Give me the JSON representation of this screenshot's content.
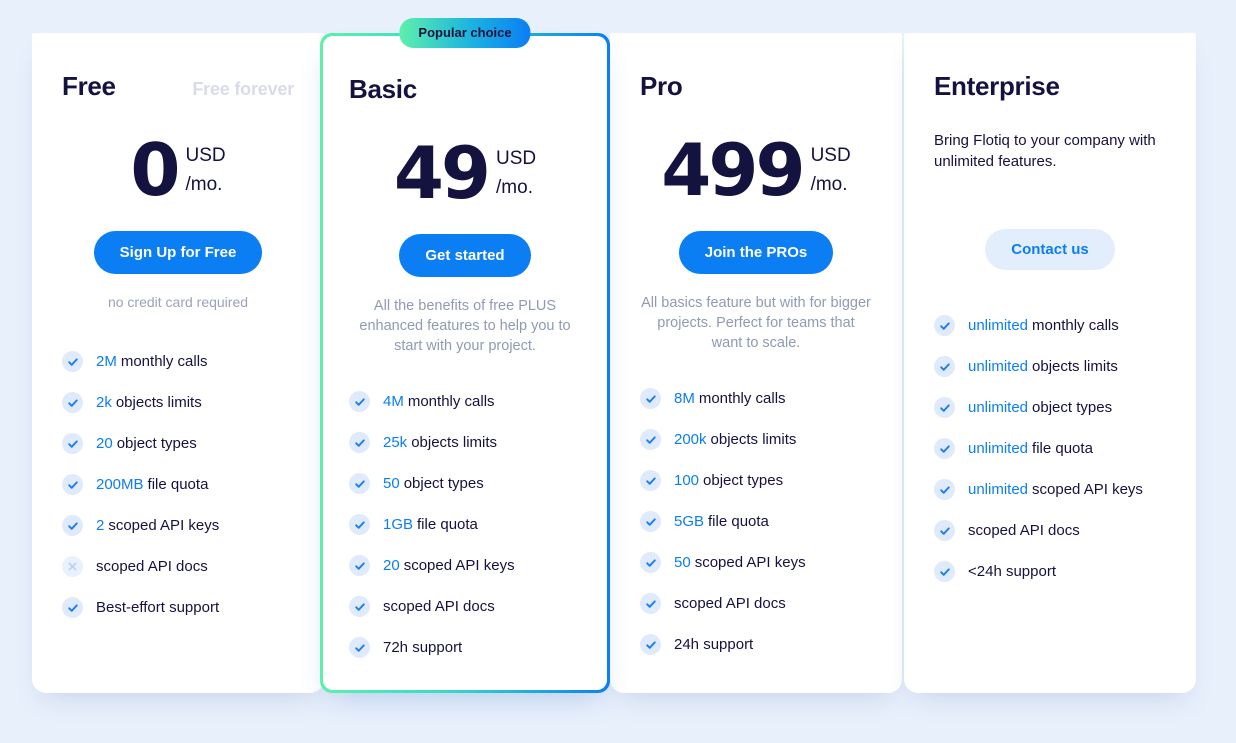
{
  "theme": {
    "page_bg": "#e8f0fc",
    "accent_blue": "#0b7ef4",
    "accent_green": "#5ef0ab",
    "text_navy": "#14123f",
    "muted": "#8f9bb3",
    "icon_bg": "#dfeafc"
  },
  "badge": {
    "label": "Popular choice"
  },
  "plans": [
    {
      "name": "Free",
      "tag": "Free forever",
      "price": "0",
      "currency": "USD",
      "period": "/mo.",
      "cta": "Sign Up for Free",
      "note": "no credit card required",
      "features": [
        {
          "icon": "check-icon",
          "highlight": "2M",
          "text": "monthly calls"
        },
        {
          "icon": "check-icon",
          "highlight": "2k",
          "text": "objects limits"
        },
        {
          "icon": "check-icon",
          "highlight": "20",
          "text": "object types"
        },
        {
          "icon": "check-icon",
          "highlight": "200MB",
          "text": "file quota"
        },
        {
          "icon": "check-icon",
          "highlight": "2",
          "text": "scoped API keys"
        },
        {
          "icon": "cross-icon",
          "highlight": "",
          "text": "scoped API docs"
        },
        {
          "icon": "check-icon",
          "highlight": "",
          "text": "Best-effort support"
        }
      ]
    },
    {
      "name": "Basic",
      "tag": "",
      "price": "49",
      "currency": "USD",
      "period": "/mo.",
      "cta": "Get started",
      "blurb": "All the benefits of free PLUS enhanced features to help you to start with your project.",
      "features": [
        {
          "icon": "check-icon",
          "highlight": "4M",
          "text": "monthly calls"
        },
        {
          "icon": "check-icon",
          "highlight": "25k",
          "text": "objects limits"
        },
        {
          "icon": "check-icon",
          "highlight": "50",
          "text": "object types"
        },
        {
          "icon": "check-icon",
          "highlight": "1GB",
          "text": "file quota"
        },
        {
          "icon": "check-icon",
          "highlight": "20",
          "text": "scoped API keys"
        },
        {
          "icon": "check-icon",
          "highlight": "",
          "text": "scoped API docs"
        },
        {
          "icon": "check-icon",
          "highlight": "",
          "text": "72h support"
        }
      ]
    },
    {
      "name": "Pro",
      "tag": "",
      "price": "499",
      "currency": "USD",
      "period": "/mo.",
      "cta": "Join the PROs",
      "blurb": "All basics feature but with for bigger projects. Perfect for teams that want to scale.",
      "features": [
        {
          "icon": "check-icon",
          "highlight": "8M",
          "text": "monthly calls"
        },
        {
          "icon": "check-icon",
          "highlight": "200k",
          "text": "objects limits"
        },
        {
          "icon": "check-icon",
          "highlight": "100",
          "text": "object types"
        },
        {
          "icon": "check-icon",
          "highlight": "5GB",
          "text": "file quota"
        },
        {
          "icon": "check-icon",
          "highlight": "50",
          "text": "scoped API keys"
        },
        {
          "icon": "check-icon",
          "highlight": "",
          "text": "scoped API docs"
        },
        {
          "icon": "check-icon",
          "highlight": "",
          "text": "24h support"
        }
      ]
    },
    {
      "name": "Enterprise",
      "tag": "",
      "description": "Bring Flotiq to your company with unlimited features.",
      "cta": "Contact us",
      "features": [
        {
          "icon": "check-icon",
          "highlight": "unlimited",
          "text": "monthly calls"
        },
        {
          "icon": "check-icon",
          "highlight": "unlimited",
          "text": "objects limits"
        },
        {
          "icon": "check-icon",
          "highlight": "unlimited",
          "text": "object types"
        },
        {
          "icon": "check-icon",
          "highlight": "unlimited",
          "text": "file quota"
        },
        {
          "icon": "check-icon",
          "highlight": "unlimited",
          "text": "scoped API keys"
        },
        {
          "icon": "check-icon",
          "highlight": "",
          "text": "scoped API docs"
        },
        {
          "icon": "check-icon",
          "highlight": "",
          "text": "<24h support"
        }
      ]
    }
  ]
}
